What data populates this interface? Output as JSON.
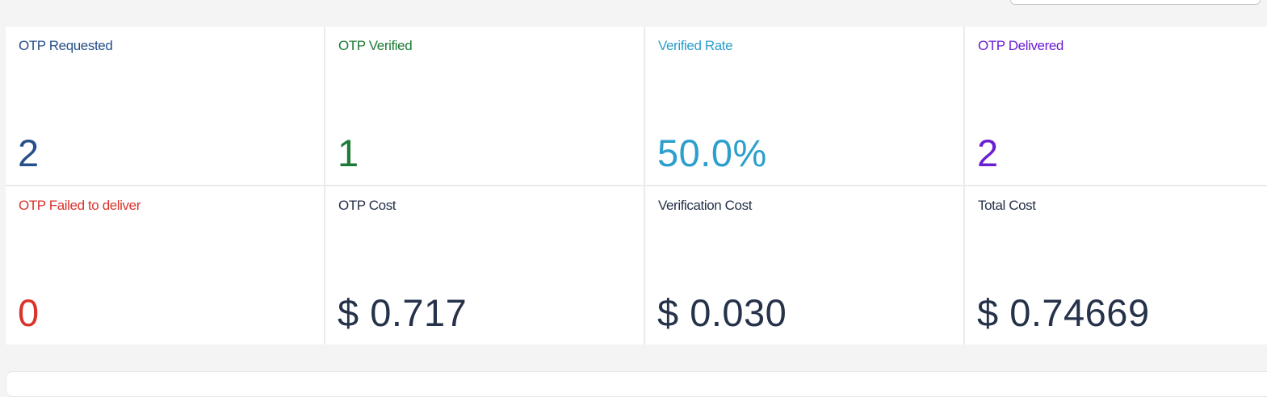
{
  "colors": {
    "blue": "#27508a",
    "green": "#1d7a36",
    "cyan": "#2c9fcc",
    "purple": "#6a1fd4",
    "red": "#d9342b",
    "dark": "#26324a"
  },
  "stats": [
    {
      "label": "OTP Requested",
      "value": "2",
      "color": "#27508a"
    },
    {
      "label": "OTP Verified",
      "value": "1",
      "color": "#1d7a36"
    },
    {
      "label": "Verified Rate",
      "value": "50.0%",
      "color": "#2c9fcc"
    },
    {
      "label": "OTP Delivered",
      "value": "2",
      "color": "#6a1fd4"
    },
    {
      "label": "OTP Failed to deliver",
      "value": "0",
      "color": "#d9342b"
    },
    {
      "label": "OTP Cost",
      "value": "$ 0.717",
      "color": "#26324a"
    },
    {
      "label": "Verification Cost",
      "value": "$ 0.030",
      "color": "#26324a"
    },
    {
      "label": "Total Cost",
      "value": "$ 0.74669",
      "color": "#26324a"
    }
  ]
}
